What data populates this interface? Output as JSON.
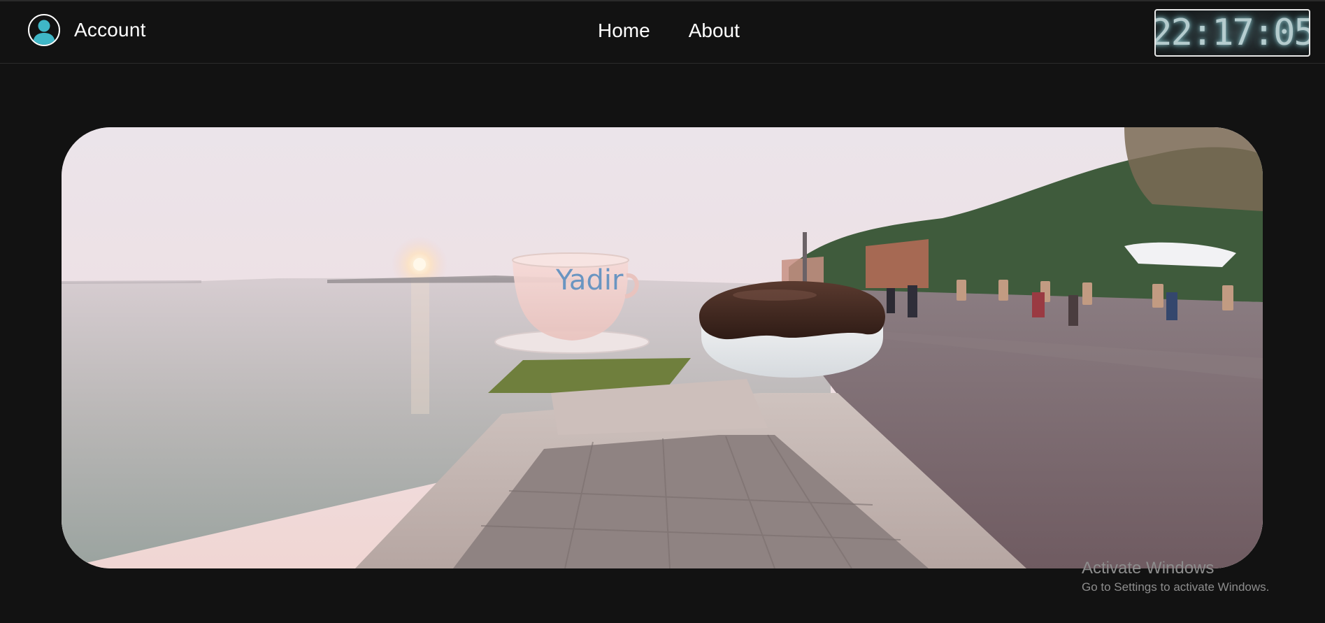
{
  "navbar": {
    "account_label": "Account",
    "account_icon": "user-icon",
    "links": [
      {
        "label": "Home"
      },
      {
        "label": "About"
      }
    ],
    "clock_time": "22:17:05"
  },
  "scene": {
    "cup_text": "Yadir"
  },
  "watermark": {
    "title": "Activate Windows",
    "subtitle": "Go to Settings to activate Windows."
  },
  "colors": {
    "background": "#121212",
    "text": "#ffffff",
    "accent_avatar": "#3fb6c6",
    "watermark_text": "#8d8d8d"
  }
}
